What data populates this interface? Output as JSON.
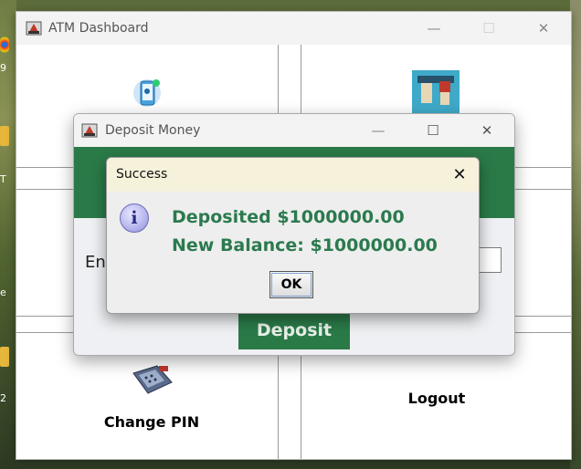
{
  "desktop": {
    "labels": [
      "9",
      "T",
      "e",
      "2"
    ]
  },
  "dashboard": {
    "title": "ATM Dashboard",
    "controls": {
      "minimize": "—",
      "maximize": "☐",
      "close": "✕"
    },
    "tiles": {
      "change_pin": "Change PIN",
      "logout": "Logout"
    }
  },
  "deposit": {
    "title": "Deposit Money",
    "controls": {
      "minimize": "—",
      "maximize": "☐",
      "close": "✕"
    },
    "enter_label": "Ent",
    "button": "Deposit"
  },
  "dialog": {
    "title": "Success",
    "close": "✕",
    "icon_glyph": "i",
    "line1": "Deposited $1000000.00",
    "line2": "New Balance: $1000000.00",
    "ok": "OK"
  }
}
